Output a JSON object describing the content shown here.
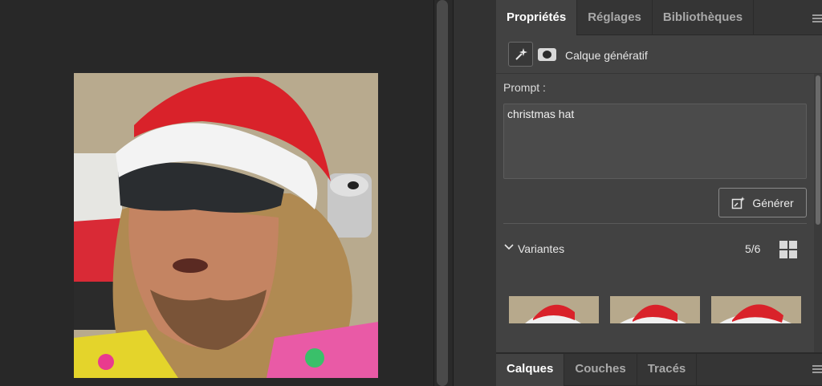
{
  "properties_panel": {
    "tabs": [
      "Propriétés",
      "Réglages",
      "Bibliothèques"
    ],
    "layer_type": "Calque génératif",
    "prompt_label": "Prompt :",
    "prompt_value": "christmas hat",
    "generate_label": "Générer",
    "variants_label": "Variantes",
    "variants_count": "5/6"
  },
  "layers_panel": {
    "tabs": [
      "Calques",
      "Couches",
      "Tracés"
    ]
  },
  "icons": [
    "generative-sparkle-icon",
    "mask-icon",
    "generate-icon",
    "chevron-down-icon",
    "grid-view-icon",
    "panel-menu-icon"
  ],
  "colors": {
    "panel_bg": "#424242",
    "tab_bar_bg": "#353535",
    "canvas_bg": "#282828",
    "hat_red": "#d9222a"
  }
}
